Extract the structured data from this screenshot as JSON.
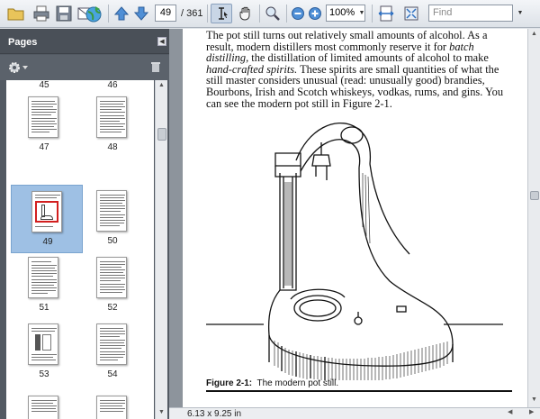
{
  "toolbar": {
    "page_current": "49",
    "page_total": "/ 361",
    "zoom": "100%",
    "find_placeholder": "Find"
  },
  "panel": {
    "title": "Pages",
    "thumbnails": [
      {
        "label": "45"
      },
      {
        "label": "46"
      },
      {
        "label": "47"
      },
      {
        "label": "48"
      },
      {
        "label": "49",
        "selected": true
      },
      {
        "label": "50"
      },
      {
        "label": "51"
      },
      {
        "label": "52"
      },
      {
        "label": "53"
      },
      {
        "label": "54"
      }
    ]
  },
  "document": {
    "paragraph_1": "The pot still turns out relatively small amounts of alcohol. As a result, modern distillers most commonly reserve it for ",
    "paragraph_italic_1": "batch distilling,",
    "paragraph_2": " the distillation of limited amounts of alcohol to make ",
    "paragraph_italic_2": "hand-crafted spirits.",
    "paragraph_3": " These spirits are small quantities of what the still master considers unusual (read: unusually good) brandies, Bourbons, Irish and Scotch whiskeys, vodkas, rums, and gins. You can see the modern pot still in Figure 2-1.",
    "caption_label": "Figure 2-1:",
    "caption_text": "The modern pot still."
  },
  "status": {
    "page_size": "6.13 x 9.25 in"
  },
  "colors": {
    "selection": "#9ec0e4",
    "panel_bg": "#535a63",
    "doc_bg": "#8d949c"
  }
}
